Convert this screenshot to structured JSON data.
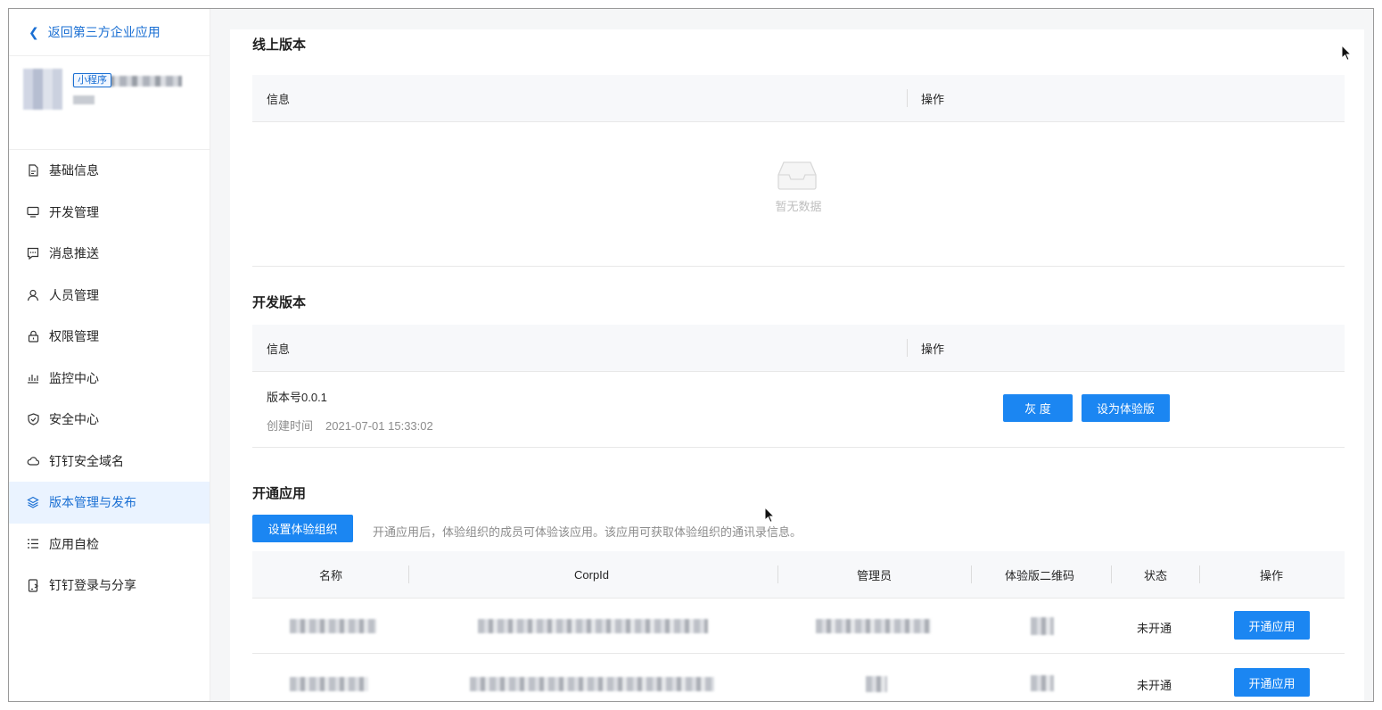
{
  "sidebar": {
    "back_label": "返回第三方企业应用",
    "app_tag": "小程序",
    "items": [
      {
        "label": "基础信息",
        "icon": "document-icon"
      },
      {
        "label": "开发管理",
        "icon": "monitor-icon"
      },
      {
        "label": "消息推送",
        "icon": "message-icon"
      },
      {
        "label": "人员管理",
        "icon": "user-icon"
      },
      {
        "label": "权限管理",
        "icon": "lock-icon"
      },
      {
        "label": "监控中心",
        "icon": "bar-chart-icon"
      },
      {
        "label": "安全中心",
        "icon": "shield-icon"
      },
      {
        "label": "钉钉安全域名",
        "icon": "cloud-icon"
      },
      {
        "label": "版本管理与发布",
        "icon": "layers-icon",
        "active": true
      },
      {
        "label": "应用自检",
        "icon": "checklist-icon"
      },
      {
        "label": "钉钉登录与分享",
        "icon": "phone-share-icon"
      }
    ]
  },
  "online_version": {
    "title": "线上版本",
    "columns": [
      "信息",
      "操作"
    ],
    "empty_text": "暂无数据"
  },
  "dev_version": {
    "title": "开发版本",
    "columns": [
      "信息",
      "操作"
    ],
    "version_label": "版本号0.0.1",
    "created_label": "创建时间",
    "created_value": "2021-07-01 15:33:02",
    "gray_button": "灰 度",
    "trial_button": "设为体验版"
  },
  "open_apps": {
    "title": "开通应用",
    "set_org_button": "设置体验组织",
    "hint": "开通应用后，体验组织的成员可体验该应用。该应用可获取体验组织的通讯录信息。",
    "columns": [
      "名称",
      "CorpId",
      "管理员",
      "体验版二维码",
      "状态",
      "操作"
    ],
    "rows": [
      {
        "status": "未开通",
        "action": "开通应用"
      },
      {
        "status": "未开通",
        "action": "开通应用"
      }
    ]
  },
  "colors": {
    "primary": "#1b86f2",
    "link": "#1a6fd3",
    "active_bg": "#eaf3ff"
  }
}
